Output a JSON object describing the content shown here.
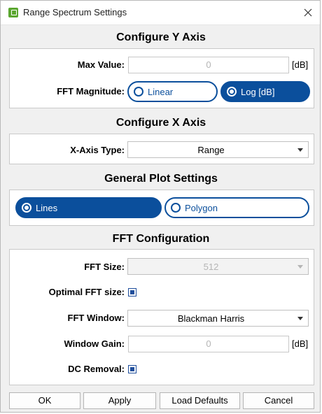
{
  "window": {
    "title": "Range Spectrum Settings",
    "app_icon": "app-icon",
    "close_icon": "close-icon"
  },
  "y_axis": {
    "heading": "Configure Y Axis",
    "max_value_label": "Max Value:",
    "max_value": "0",
    "max_value_unit": "[dB]",
    "fft_magnitude_label": "FFT Magnitude:",
    "options": [
      "Linear",
      "Log [dB]"
    ],
    "selected": "Log [dB]"
  },
  "x_axis": {
    "heading": "Configure X Axis",
    "type_label": "X-Axis Type:",
    "type_value": "Range"
  },
  "plot": {
    "heading": "General Plot Settings",
    "options": [
      "Lines",
      "Polygon"
    ],
    "selected": "Lines"
  },
  "fft": {
    "heading": "FFT Configuration",
    "size_label": "FFT Size:",
    "size_value": "512",
    "optimal_label": "Optimal FFT size:",
    "optimal_checked": true,
    "window_label": "FFT Window:",
    "window_value": "Blackman Harris",
    "gain_label": "Window Gain:",
    "gain_value": "0",
    "gain_unit": "[dB]",
    "dc_label": "DC Removal:",
    "dc_checked": true
  },
  "buttons": {
    "ok": "OK",
    "apply": "Apply",
    "load_defaults": "Load Defaults",
    "cancel": "Cancel"
  },
  "colors": {
    "accent": "#0b4f9c",
    "checkbox": "#1f4e9c",
    "app_icon": "#5aa62f"
  }
}
